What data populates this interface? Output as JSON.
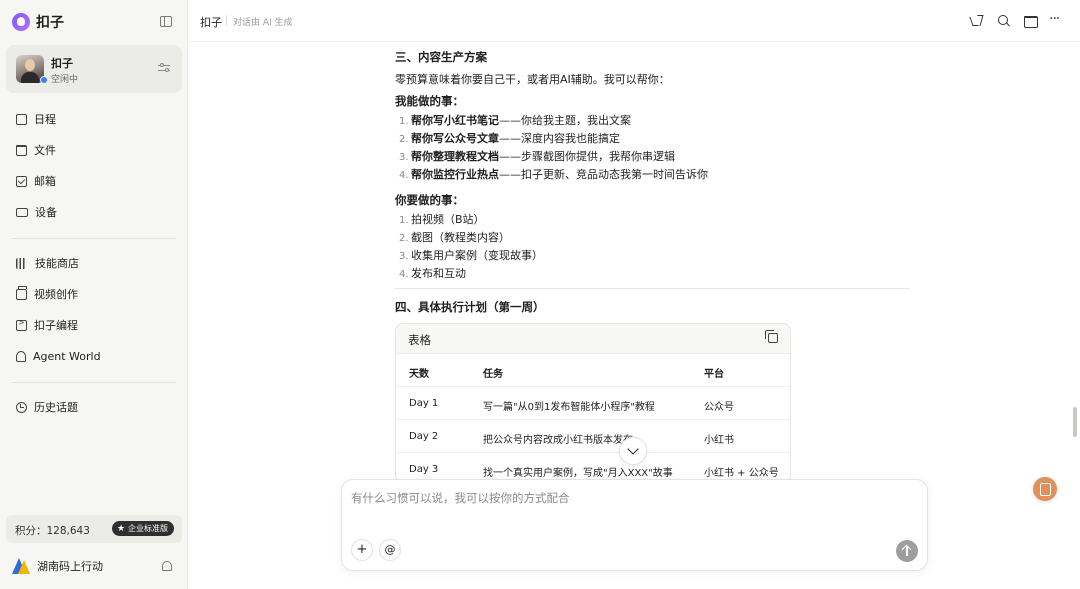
{
  "app": {
    "name": "扣子"
  },
  "profile": {
    "name": "扣子",
    "status": "空闲中"
  },
  "nav": {
    "group1": [
      {
        "label": "日程"
      },
      {
        "label": "文件"
      },
      {
        "label": "邮箱"
      },
      {
        "label": "设备"
      }
    ],
    "group2": [
      {
        "label": "技能商店"
      },
      {
        "label": "视频创作"
      },
      {
        "label": "扣子编程"
      },
      {
        "label": "Agent World"
      }
    ],
    "group3": [
      {
        "label": "历史话题"
      }
    ]
  },
  "points": {
    "text": "积分：128,643",
    "badge": "企业标准版"
  },
  "org": {
    "name": "湖南码上行动"
  },
  "header": {
    "title": "扣子",
    "subtitle": "对话由 AI 生成"
  },
  "message": {
    "section3_title": "三、内容生产方案",
    "section3_intro": "零预算意味着你要自己干，或者用AI辅助。我可以帮你：",
    "can_do_title": "我能做的事：",
    "can_do": [
      {
        "num": "1.",
        "bold": "帮你写小红书笔记",
        "rest": "——你给我主题，我出文案"
      },
      {
        "num": "2.",
        "bold": "帮你写公众号文章",
        "rest": "——深度内容我也能搞定"
      },
      {
        "num": "3.",
        "bold": "帮你整理教程文档",
        "rest": "——步骤截图你提供，我帮你串逻辑"
      },
      {
        "num": "4.",
        "bold": "帮你监控行业热点",
        "rest": "——扣子更新、竞品动态我第一时间告诉你"
      }
    ],
    "you_do_title": "你要做的事：",
    "you_do": [
      {
        "num": "1.",
        "text": "拍视频（B站）"
      },
      {
        "num": "2.",
        "text": "截图（教程类内容）"
      },
      {
        "num": "3.",
        "text": "收集用户案例（变现故事）"
      },
      {
        "num": "4.",
        "text": "发布和互动"
      }
    ],
    "section4_title": "四、具体执行计划（第一周）"
  },
  "table": {
    "title": "表格",
    "columns": [
      "天数",
      "任务",
      "平台"
    ],
    "rows": [
      [
        "Day 1",
        "写一篇\"从0到1发布智能体小程序\"教程",
        "公众号"
      ],
      [
        "Day 2",
        "把公众号内容改成小红书版本发布",
        "小红书"
      ],
      [
        "Day 3",
        "找一个真实用户案例，写成\"月入XXX\"故事",
        "小红书 + 公众号"
      ]
    ]
  },
  "composer": {
    "placeholder": "有什么习惯可以说，我可以按你的方式配合",
    "plus": "+",
    "at": "@"
  },
  "icons": {
    "more": "···"
  }
}
